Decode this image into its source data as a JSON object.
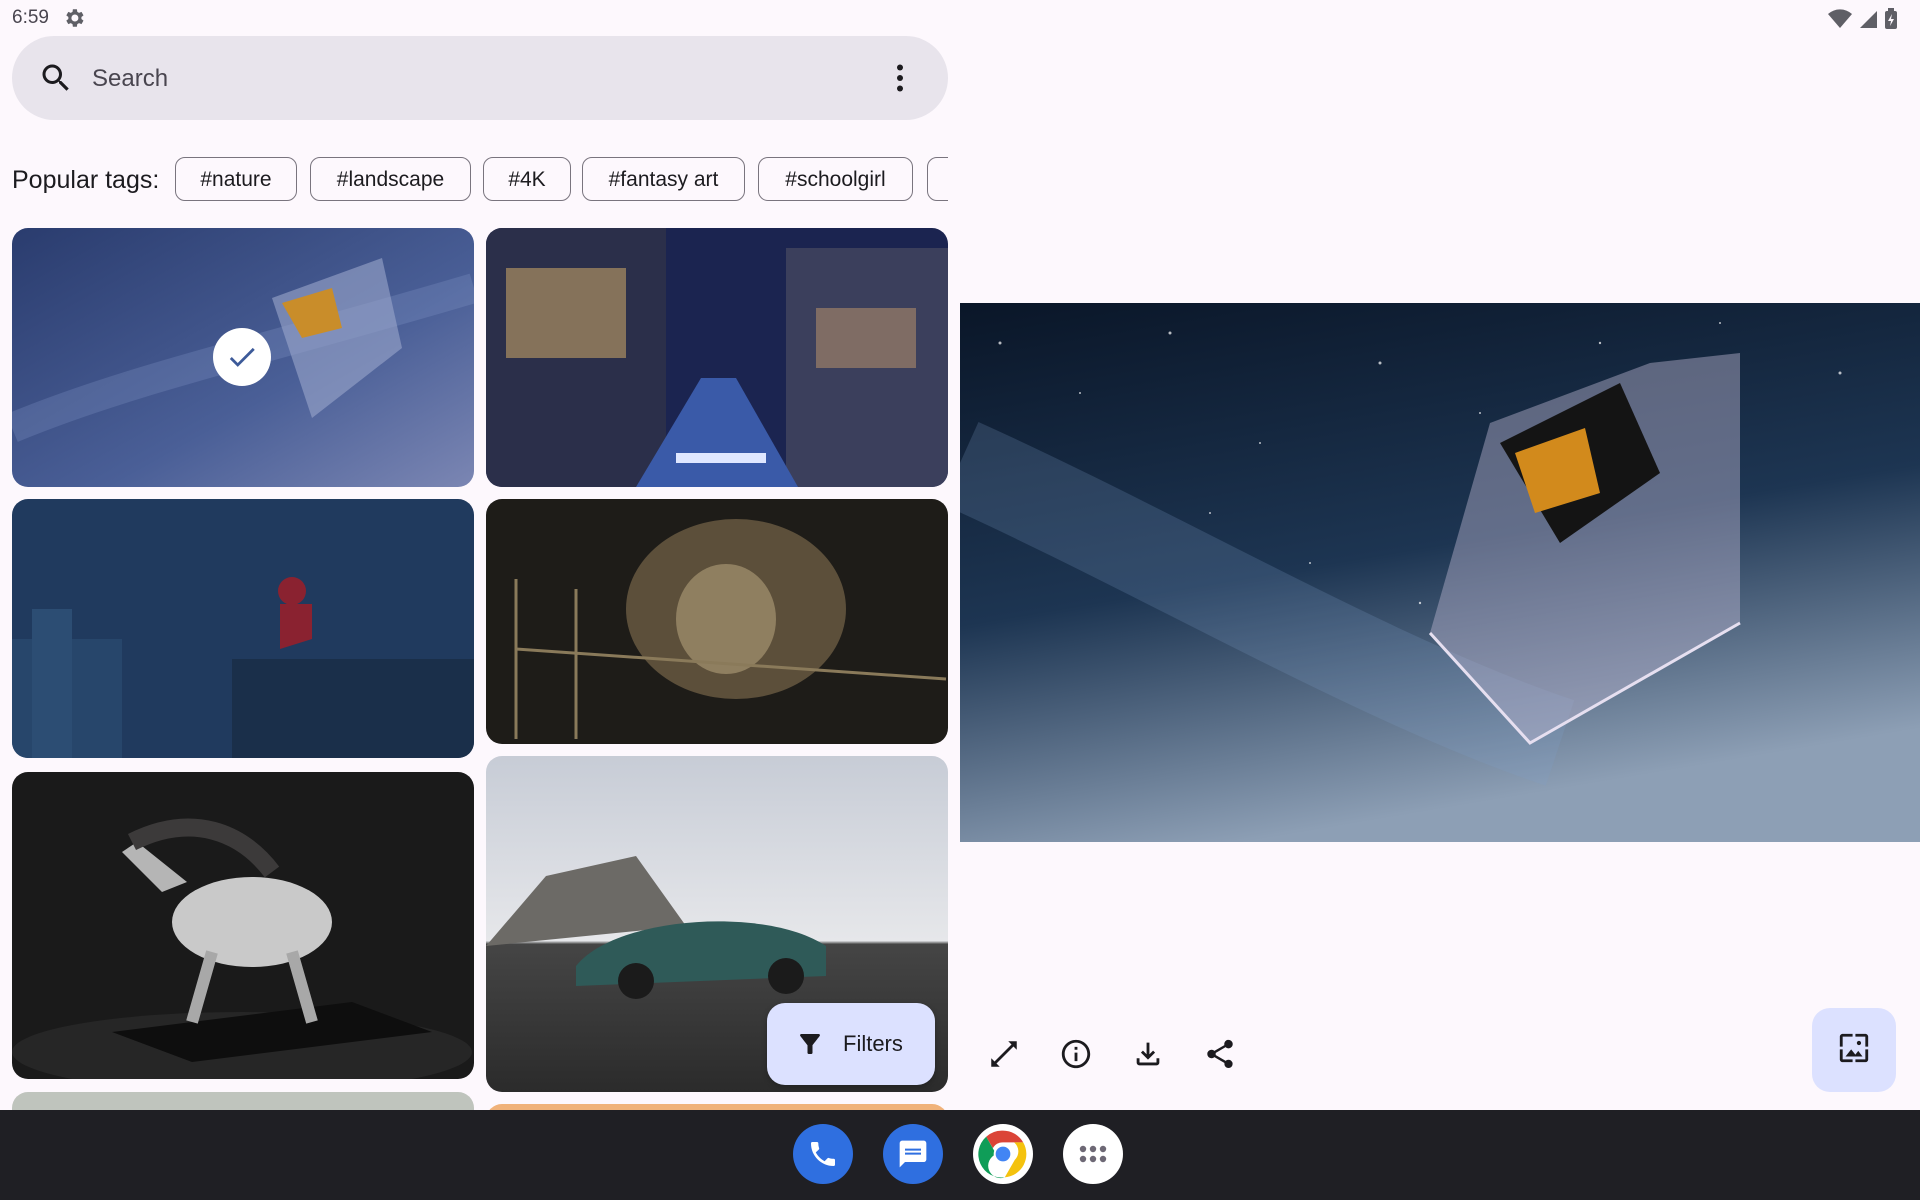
{
  "status_bar": {
    "time": "6:59",
    "icons": [
      "settings-gear-icon",
      "wifi-icon",
      "cellular-signal-icon",
      "battery-icon"
    ]
  },
  "search": {
    "placeholder": "Search",
    "value": "",
    "leading_icon": "search-icon",
    "trailing_icon": "more-vert-icon"
  },
  "tags": {
    "label": "Popular tags:",
    "items": [
      "#nature",
      "#landscape",
      "#4K",
      "#fantasy art",
      "#schoolgirl"
    ]
  },
  "grid": {
    "items": [
      {
        "subject": "James Webb telescope in space",
        "selected": true
      },
      {
        "subject": "Anime street at night",
        "selected": false
      },
      {
        "subject": "Spider-Man in the rain",
        "selected": false
      },
      {
        "subject": "Sandman dark scene",
        "selected": false
      },
      {
        "subject": "White horse sculpture",
        "selected": false
      },
      {
        "subject": "Teal sports car",
        "selected": false
      }
    ]
  },
  "filters_button": {
    "label": "Filters",
    "icon": "filter-icon"
  },
  "preview": {
    "subject": "James Webb telescope in space"
  },
  "actions": [
    {
      "name": "fullscreen-icon"
    },
    {
      "name": "info-icon"
    },
    {
      "name": "download-icon"
    },
    {
      "name": "share-icon"
    }
  ],
  "set_wallpaper_button": {
    "icon": "wallpaper-icon"
  },
  "taskbar": {
    "apps": [
      "phone-app-icon",
      "messages-app-icon",
      "chrome-app-icon",
      "app-drawer-icon"
    ]
  },
  "colors": {
    "background": "#fdf8fd",
    "search_bar": "#e8e4ec",
    "fab": "#dce1ff",
    "taskbar": "#1f1f24"
  }
}
